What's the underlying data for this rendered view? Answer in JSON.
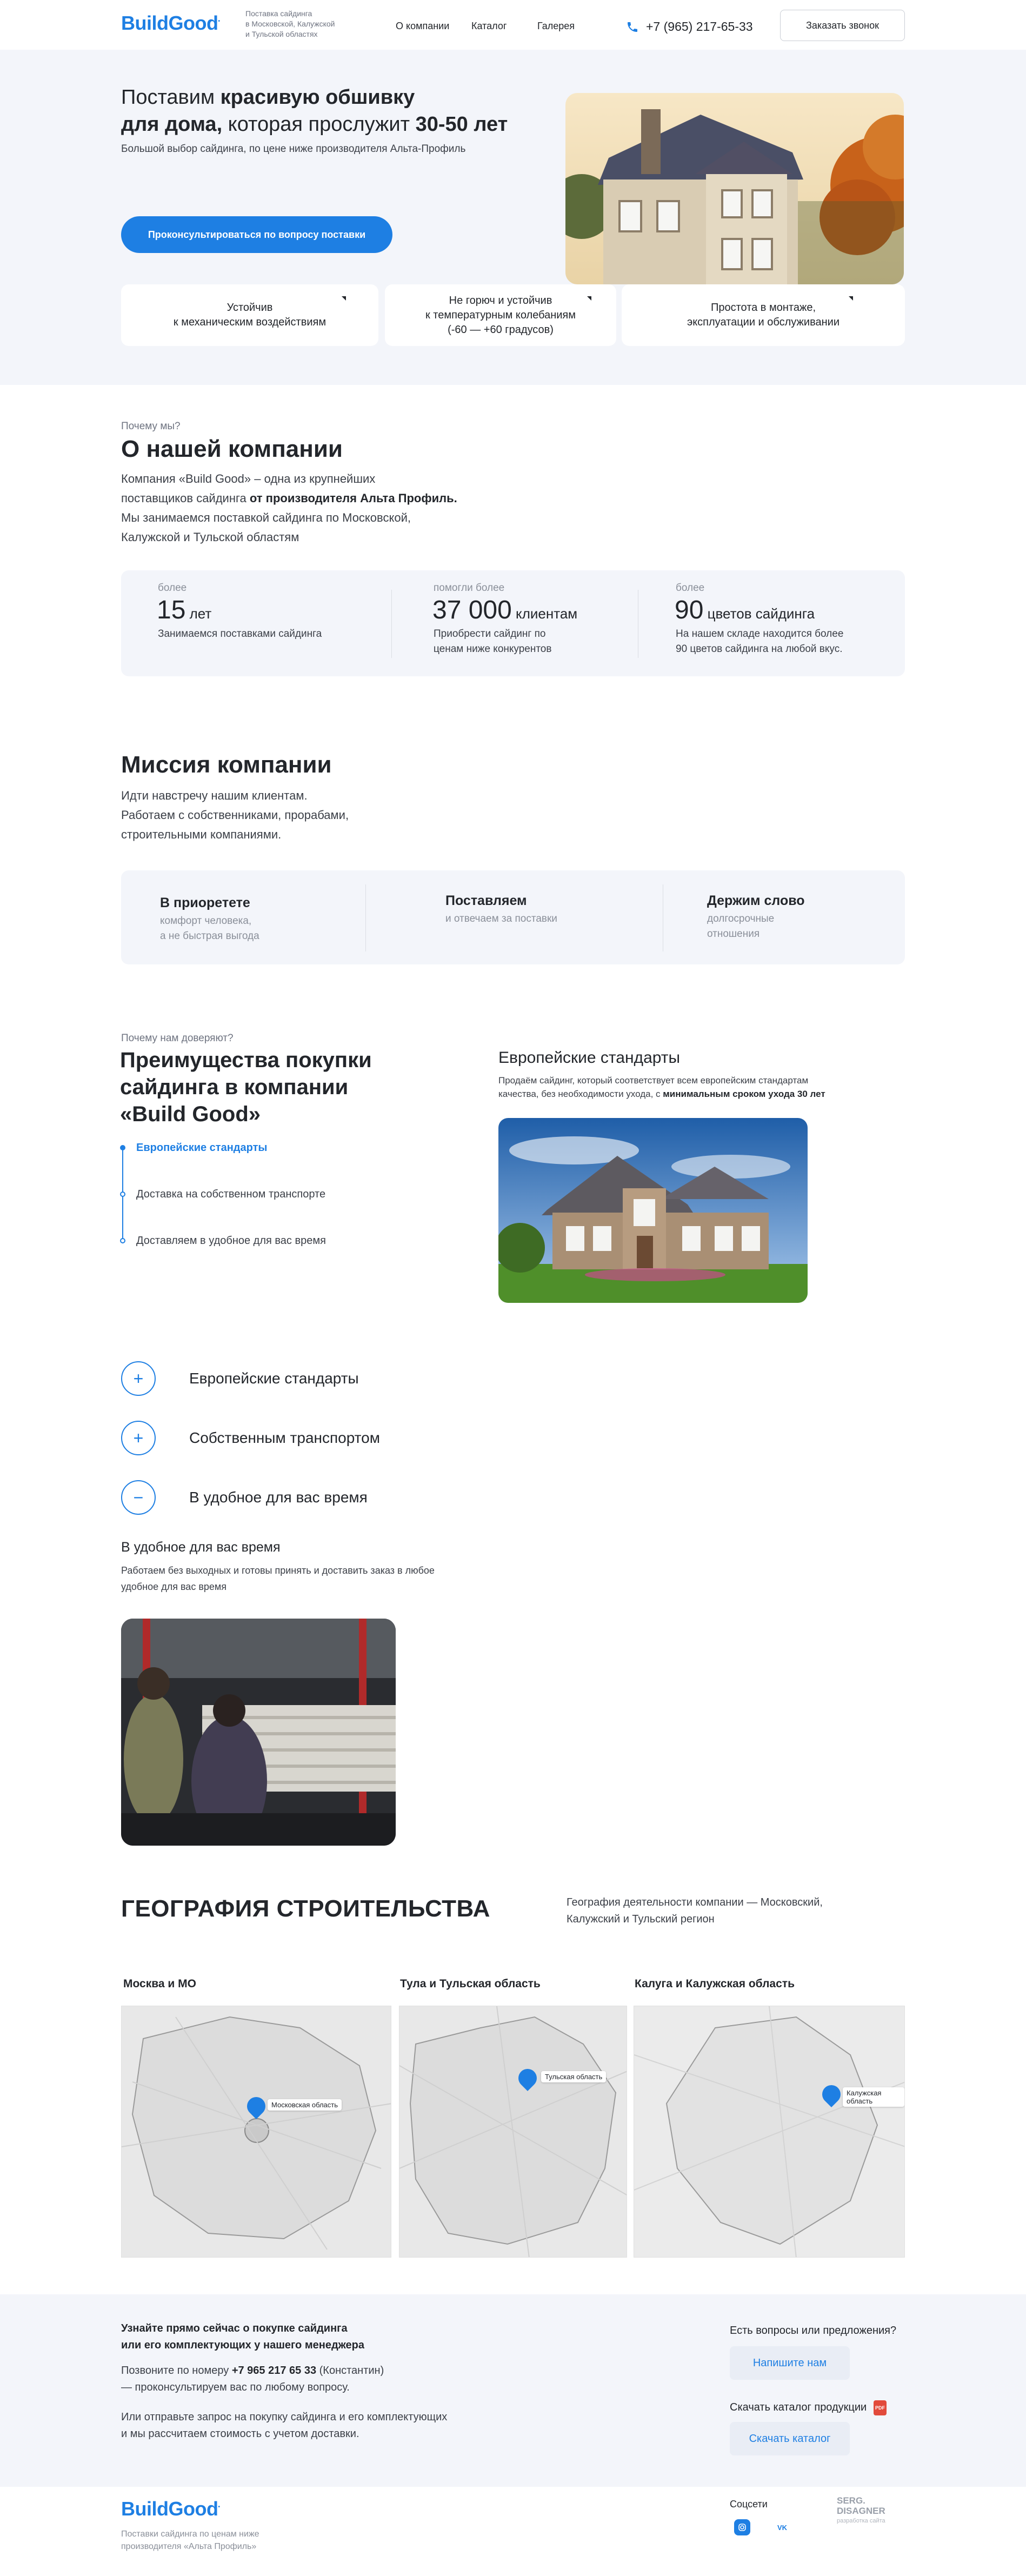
{
  "header": {
    "logo": "BuildGood",
    "tagline": [
      "Поставка сайдинга",
      "в Московской, Калужской",
      "и Тульской областях"
    ],
    "nav": [
      "О компании",
      "Каталог",
      "Галерея"
    ],
    "phone": "+7 (965) 217-65-33",
    "callback": "Заказать звонок"
  },
  "hero": {
    "title_1": "Поставим ",
    "title_1b": "красивую обшивку",
    "title_2b": "для дома,",
    "title_2": " которая прослужит ",
    "title_2c": "30-50 лет",
    "subtitle": "Большой выбор сайдинга, по цене ниже производителя Альта-Профиль",
    "cta": "Проконсультироваться по вопросу поставки",
    "features": [
      [
        "Устойчив",
        "к механическим воздействиям"
      ],
      [
        "Не горюч и устойчив",
        "к температурным колебаниям",
        "(-60 — +60 градусов)"
      ],
      [
        "Простота в монтаже,",
        "эксплуатации и обслуживании"
      ]
    ]
  },
  "about": {
    "eyebrow": "Почему мы?",
    "title": "О нашей компании",
    "p1": "Компания «Build Good» – одна из крупнейших",
    "p2a": "поставщиков сайдинга ",
    "p2b": "от производителя Альта Профиль.",
    "p3": "Мы занимаемся поставкой сайдинга по Московской,",
    "p4": "Калужской и Тульской областям",
    "stats": [
      {
        "small": "более",
        "big": "15",
        "unit": " лет",
        "desc": [
          "Занимаемся поставками сайдинга"
        ]
      },
      {
        "small": "помогли более",
        "big": "37 000",
        "unit": "  клиентам",
        "desc": [
          "Приобрести сайдинг по",
          "ценам ниже конкурентов"
        ]
      },
      {
        "small": "более",
        "big": "90",
        "unit": " цветов сайдинга",
        "desc": [
          "На нашем складе находится более",
          "90 цветов сайдинга на любой вкус."
        ]
      }
    ]
  },
  "mission": {
    "title": "Миссия компании",
    "lines": [
      "Идти навстречу нашим клиентам.",
      "Работаем с собственниками, прорабами,",
      "строительными компаниями."
    ],
    "cards": [
      {
        "title": "В приорететe",
        "sub": [
          "комфорт человека,",
          "а не быстрая выгода"
        ]
      },
      {
        "title": "Поставляем",
        "sub": [
          "и отвечаем за поставки"
        ]
      },
      {
        "title": "Держим слово",
        "sub": [
          "долгосрочные",
          "отношения"
        ]
      }
    ]
  },
  "advantages": {
    "eyebrow": "Почему нам доверяют?",
    "title": [
      "Преимущества покупки",
      "сайдинга в компании",
      "«Build Good»"
    ],
    "items": [
      "Европейские стандарты",
      "Доставка на собственном транспорте",
      "Доставляем в удобное для вас время"
    ],
    "right_title": "Европейские стандарты",
    "right_text_1": "Продаём сайдинг, который соответствует всем европейским стандартам",
    "right_text_2a": "качества, без необходимости ухода, с ",
    "right_text_2b": "минимальным сроком ухода 30 лет"
  },
  "accordion": {
    "items": [
      {
        "icon": "+",
        "label": "Европейские стандарты"
      },
      {
        "icon": "+",
        "label": "Собственным транспортом"
      },
      {
        "icon": "−",
        "label": "В удобное для вас время"
      }
    ],
    "open_title": "В удобное для вас время",
    "open_text": [
      "Работаем без выходных и готовы принять и доставить заказ в любое",
      "удобное для вас время"
    ]
  },
  "geo": {
    "title": "ГЕОГРАФИЯ СТРОИТЕЛЬСТВА",
    "desc": [
      "География деятельности компании — Московский,",
      "Калужский и Тульский регион"
    ],
    "maps": [
      {
        "title": "Москва и МО",
        "pin": "Московская область"
      },
      {
        "title": "Тула и Тульская область",
        "pin": "Тульская область"
      },
      {
        "title": "Калуга и Калужская область",
        "pin": "Калужская область"
      }
    ]
  },
  "contact": {
    "bold": [
      "Узнайте прямо сейчас о покупке сайдинга",
      "или его комплектующих у нашего менеджера"
    ],
    "call_a": "Позвоните по номеру ",
    "call_b": "+7 965 217 65 33",
    "call_c": " (Константин)",
    "call_2": "— проконсультируем вас по любому вопросу.",
    "or": [
      "Или отправьте запрос на покупку сайдинга и его комплектующих",
      "и мы рассчитаем стоимость с учетом доставки."
    ],
    "q": "Есть вопросы или предложения?",
    "write": "Напишите нам",
    "download": "Скачать каталог продукции",
    "pdf": "PDF",
    "catalog": "Скачать каталог"
  },
  "footer": {
    "logo": "BuildGood",
    "tag": [
      "Поставки сайдинга по ценам ниже",
      "производителя «Альта Профиль»"
    ],
    "social": "Соцсети",
    "vk": "VK",
    "credit_1": "SERG.",
    "credit_2": "DISAGNER",
    "credit_3": "разработка сайта"
  },
  "colors": {
    "accent": "#1e7fe3",
    "bg_soft": "#f3f5fa"
  }
}
